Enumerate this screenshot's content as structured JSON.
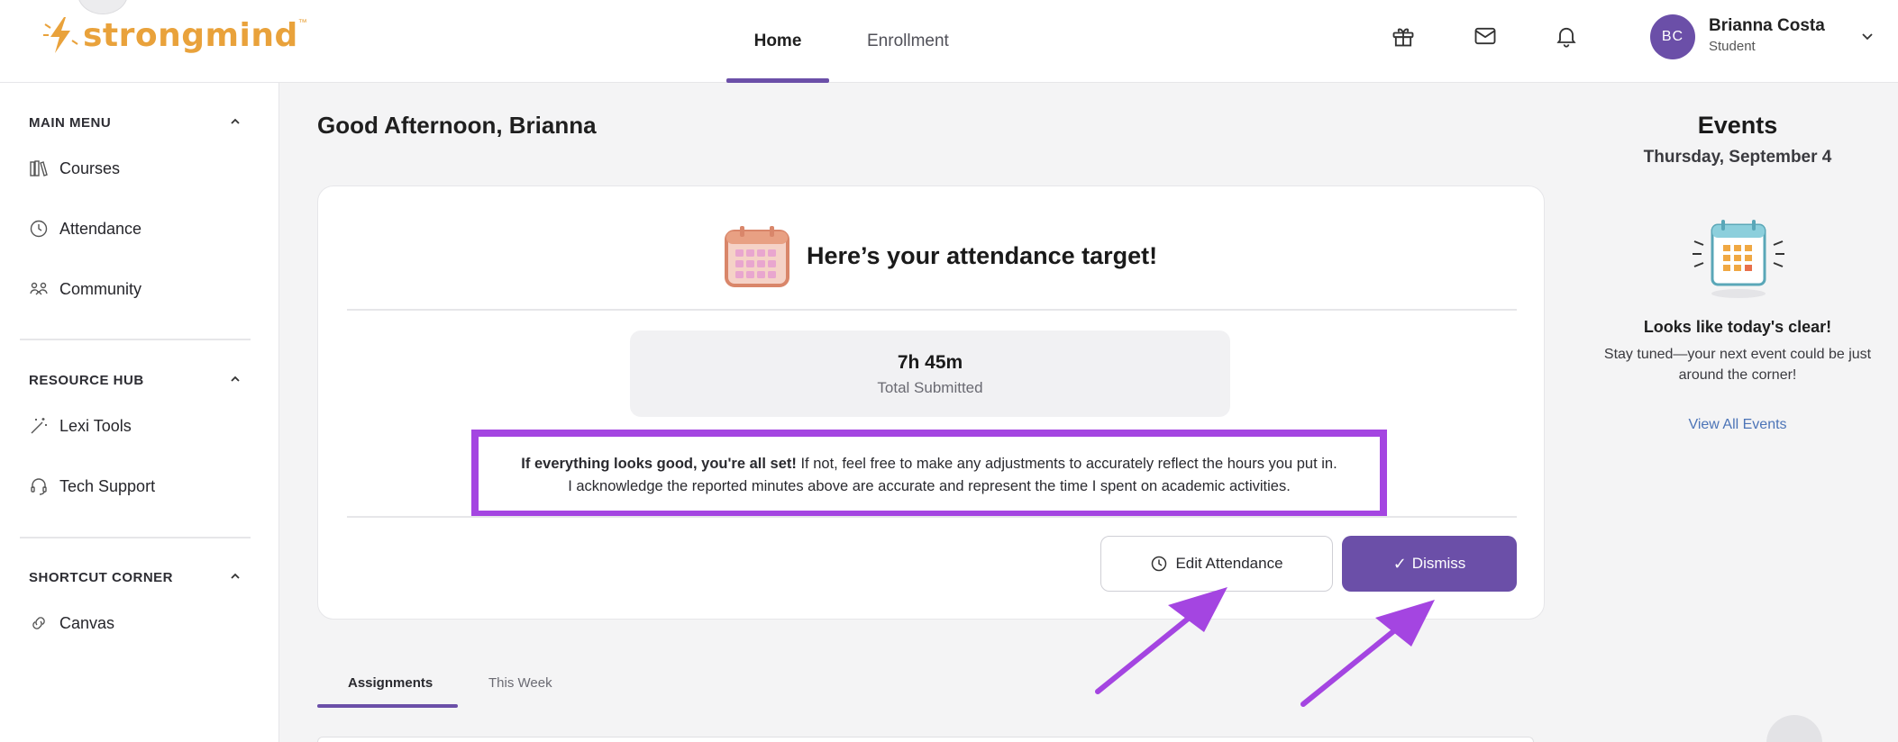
{
  "topbar": {
    "brand": "strongmind",
    "brand_tm": "™",
    "nav": [
      {
        "label": "Home",
        "active": true
      },
      {
        "label": "Enrollment",
        "active": false
      }
    ],
    "icons": [
      "gift-icon",
      "mail-icon",
      "bell-icon"
    ],
    "user": {
      "initials": "BC",
      "name": "Brianna Costa",
      "role": "Student"
    }
  },
  "sidebar": {
    "sections": [
      {
        "title": "MAIN MENU",
        "items": [
          {
            "label": "Courses",
            "icon": "books-icon"
          },
          {
            "label": "Attendance",
            "icon": "clock-icon"
          },
          {
            "label": "Community",
            "icon": "community-icon"
          }
        ]
      },
      {
        "title": "RESOURCE HUB",
        "items": [
          {
            "label": "Lexi Tools",
            "icon": "magic-wand-icon"
          },
          {
            "label": "Tech Support",
            "icon": "headset-icon"
          }
        ]
      },
      {
        "title": "SHORTCUT CORNER",
        "items": [
          {
            "label": "Canvas",
            "icon": "link-icon"
          }
        ]
      }
    ]
  },
  "main": {
    "greeting": "Good Afternoon, Brianna",
    "attendance_card": {
      "title": "Here’s your attendance target!",
      "total_value": "7h 45m",
      "total_label": "Total Submitted",
      "ack_bold": "If everything looks good, you're all set!",
      "ack_rest": " If not, feel free to make any adjustments to accurately reflect the hours you put in.",
      "ack_line2": "I acknowledge the reported minutes above are accurate and represent the time I spent on academic activities.",
      "edit_label": "Edit Attendance",
      "dismiss_label": "Dismiss"
    },
    "tabs": [
      {
        "label": "Assignments",
        "active": true
      },
      {
        "label": "This Week",
        "active": false
      }
    ]
  },
  "events": {
    "title": "Events",
    "date": "Thursday, September 4",
    "empty_title": "Looks like today's clear!",
    "empty_text": "Stay tuned—your next event could be just around the corner!",
    "view_all": "View All Events"
  },
  "colors": {
    "accent": "#6b4fa8",
    "highlight": "#a445e1",
    "brand": "#e9a23b",
    "link": "#4c74b7"
  }
}
